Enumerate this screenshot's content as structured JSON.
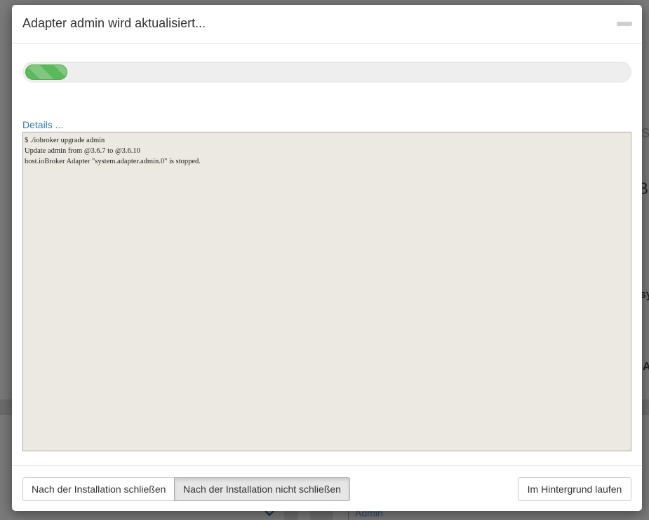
{
  "dialog": {
    "title": "Adapter admin wird aktualisiert...",
    "progress": 0.07,
    "details_label": "Details ...",
    "log": [
      "$ ./iobroker upgrade admin",
      "Update admin from @3.6.7 to @3.6.10",
      "host.ioBroker Adapter \"system.adapter.admin.0\" is stopped."
    ],
    "buttons": {
      "close_after": "Nach der Installation schließen",
      "keep_open": "Nach der Installation nicht schließen",
      "background": "Im Hintergrund laufen"
    }
  },
  "background_app": {
    "bottom_text": "Admin"
  },
  "colors": {
    "progress": "#5cb85c",
    "link": "#337ab7",
    "log_bg": "#ebe9e1"
  },
  "icons": {
    "minimize": "minimize-icon",
    "chevron": "chevron-down-icon"
  }
}
